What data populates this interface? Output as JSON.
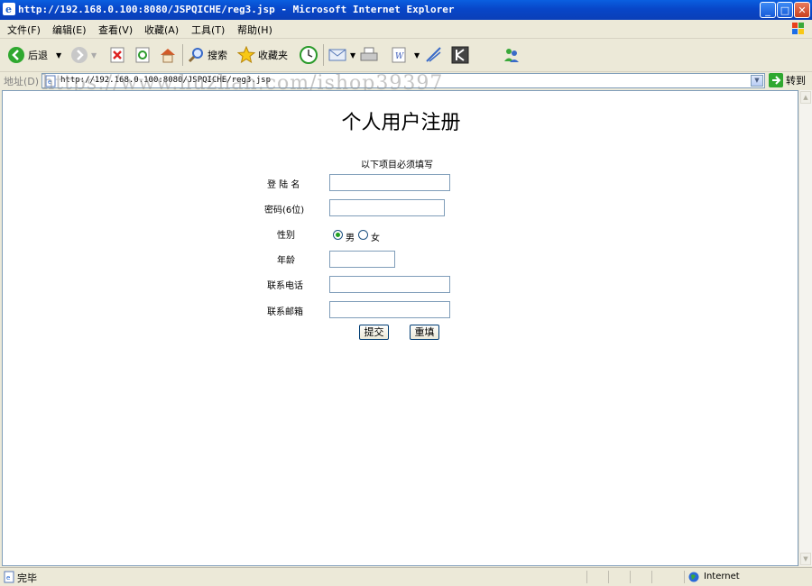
{
  "window": {
    "title": "http://192.168.0.100:8080/JSPQICHE/reg3.jsp - Microsoft Internet Explorer",
    "minimize": "_",
    "maximize": "□",
    "close": "✕"
  },
  "menu": [
    "文件(F)",
    "编辑(E)",
    "查看(V)",
    "收藏(A)",
    "工具(T)",
    "帮助(H)"
  ],
  "toolbar": {
    "back": "后退",
    "search": "搜索",
    "favorites": "收藏夹"
  },
  "address": {
    "label": "地址(D)",
    "url": "http://192.168.0.100:8080/JSPQICHE/reg3.jsp",
    "go": "转到",
    "watermark": "https://www.huzhan.com/ishop39397"
  },
  "form": {
    "title": "个人用户注册",
    "required_note": "以下项目必须填写",
    "login_name_label": "登 陆 名",
    "password_label": "密码(6位)",
    "gender_label": "性别",
    "gender_male": "男",
    "gender_female": "女",
    "age_label": "年龄",
    "phone_label": "联系电话",
    "email_label": "联系邮箱",
    "submit": "提交",
    "reset": "重填"
  },
  "status": {
    "text": "完毕",
    "zone": "Internet"
  }
}
